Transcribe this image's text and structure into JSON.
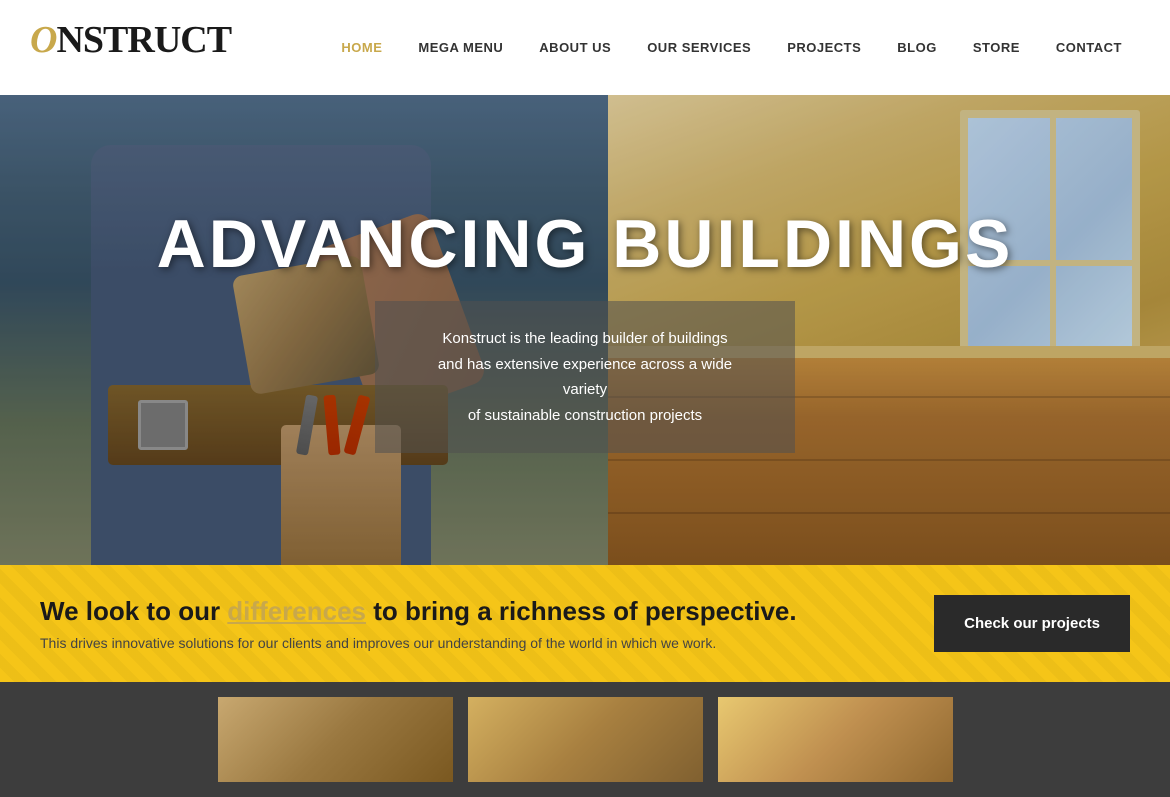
{
  "header": {
    "logo_text": "ONSTRUCT",
    "nav_items": [
      {
        "label": "HOME",
        "active": true
      },
      {
        "label": "MEGA MENU",
        "active": false
      },
      {
        "label": "ABOUT US",
        "active": false
      },
      {
        "label": "OUR SERVICES",
        "active": false
      },
      {
        "label": "PROJECTS",
        "active": false
      },
      {
        "label": "BLOG",
        "active": false
      },
      {
        "label": "STORE",
        "active": false
      },
      {
        "label": "CONTACT",
        "active": false
      }
    ]
  },
  "hero": {
    "title": "ADVANCING BUILDINGS",
    "description_line1": "Konstruct is the leading builder of buildings",
    "description_line2": "and has extensive experience across a wide variety",
    "description_line3": "of sustainable construction projects"
  },
  "banner": {
    "headline_prefix": "We look to our ",
    "headline_link": "differences",
    "headline_suffix": " to bring a richness of perspective.",
    "subtext": "This drives innovative solutions for our clients and improves our understanding of the world in which we work.",
    "cta_button": "Check our projects"
  },
  "colors": {
    "accent": "#c8a84b",
    "nav_active": "#c8a84b",
    "banner_bg": "#f5c518",
    "cta_bg": "#2a2a2a",
    "dark_section": "#3a3a3a"
  }
}
